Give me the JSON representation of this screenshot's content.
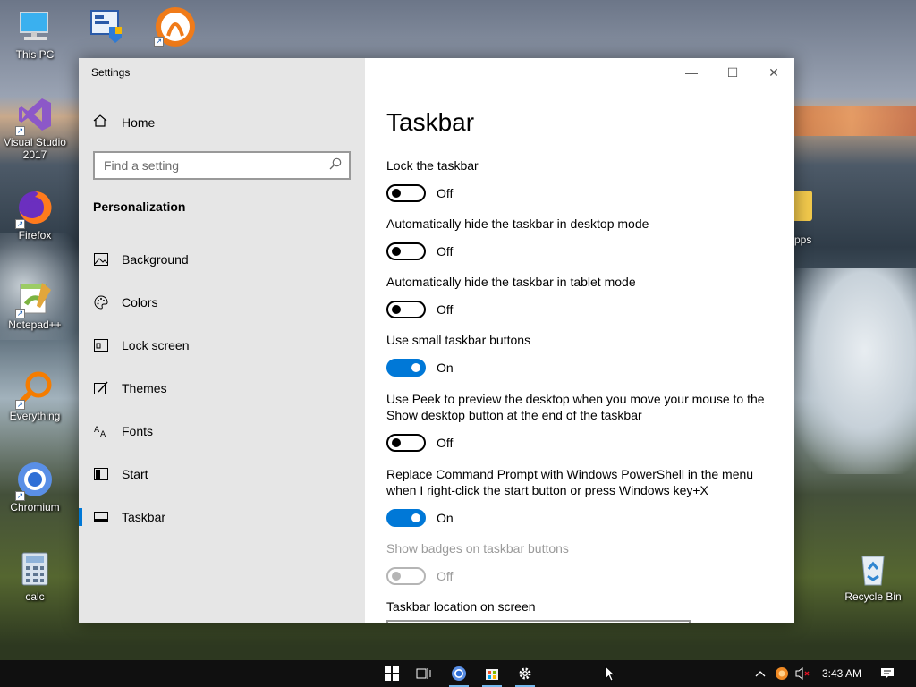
{
  "desktop": {
    "icons": [
      {
        "label": "This PC",
        "icon": "monitor-icon"
      },
      {
        "label": "",
        "icon": "control-panel-icon"
      },
      {
        "label": "",
        "icon": "bittorrent-icon"
      },
      {
        "label": "Visual Studio 2017",
        "icon": "visual-studio-icon"
      },
      {
        "label": "Firefox",
        "icon": "firefox-icon"
      },
      {
        "label": "Notepad++",
        "icon": "notepadpp-icon"
      },
      {
        "label": "Everything",
        "icon": "everything-search-icon"
      },
      {
        "label": "Chromium",
        "icon": "chromium-icon"
      },
      {
        "label": "calc",
        "icon": "calculator-icon"
      },
      {
        "label": "Recycle Bin",
        "icon": "recycle-bin-icon"
      }
    ],
    "partial_label": "pps"
  },
  "window": {
    "title": "Settings",
    "buttons": {
      "minimize": "—",
      "maximize": "☐",
      "close": "✕"
    }
  },
  "nav": {
    "home": "Home",
    "search_placeholder": "Find a setting",
    "section": "Personalization",
    "items": [
      {
        "label": "Background",
        "icon": "picture-icon"
      },
      {
        "label": "Colors",
        "icon": "palette-icon"
      },
      {
        "label": "Lock screen",
        "icon": "lock-screen-icon"
      },
      {
        "label": "Themes",
        "icon": "brush-icon"
      },
      {
        "label": "Fonts",
        "icon": "fonts-icon"
      },
      {
        "label": "Start",
        "icon": "start-icon"
      },
      {
        "label": "Taskbar",
        "icon": "taskbar-icon",
        "active": true
      }
    ]
  },
  "content": {
    "title": "Taskbar",
    "settings": [
      {
        "label": "Lock the taskbar",
        "state": "Off"
      },
      {
        "label": "Automatically hide the taskbar in desktop mode",
        "state": "Off"
      },
      {
        "label": "Automatically hide the taskbar in tablet mode",
        "state": "Off"
      },
      {
        "label": "Use small taskbar buttons",
        "state": "On"
      },
      {
        "label": "Use Peek to preview the desktop when you move your mouse to the Show desktop button at the end of the taskbar",
        "state": "Off"
      },
      {
        "label": "Replace Command Prompt with Windows PowerShell in the menu when I right-click the start button or press Windows key+X",
        "state": "On"
      },
      {
        "label": "Show badges on taskbar buttons",
        "state": "Off",
        "disabled": true
      }
    ],
    "location_label": "Taskbar location on screen"
  },
  "taskbar": {
    "clock": "3:43 AM",
    "accent": "#76b9ed"
  }
}
